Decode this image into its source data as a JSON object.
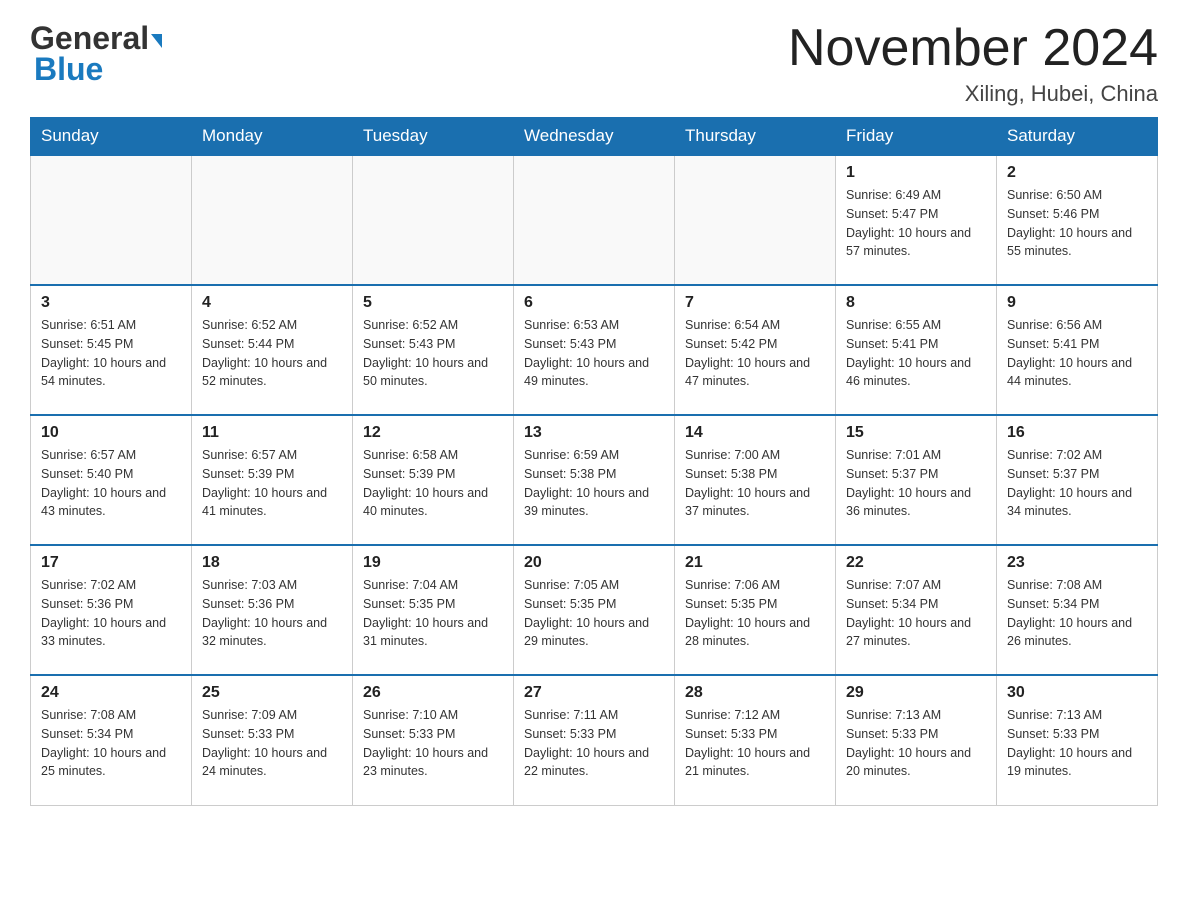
{
  "header": {
    "logo_general": "General",
    "logo_blue": "Blue",
    "month_year": "November 2024",
    "location": "Xiling, Hubei, China"
  },
  "weekdays": [
    "Sunday",
    "Monday",
    "Tuesday",
    "Wednesday",
    "Thursday",
    "Friday",
    "Saturday"
  ],
  "weeks": [
    [
      {
        "day": "",
        "sunrise": "",
        "sunset": "",
        "daylight": ""
      },
      {
        "day": "",
        "sunrise": "",
        "sunset": "",
        "daylight": ""
      },
      {
        "day": "",
        "sunrise": "",
        "sunset": "",
        "daylight": ""
      },
      {
        "day": "",
        "sunrise": "",
        "sunset": "",
        "daylight": ""
      },
      {
        "day": "",
        "sunrise": "",
        "sunset": "",
        "daylight": ""
      },
      {
        "day": "1",
        "sunrise": "Sunrise: 6:49 AM",
        "sunset": "Sunset: 5:47 PM",
        "daylight": "Daylight: 10 hours and 57 minutes."
      },
      {
        "day": "2",
        "sunrise": "Sunrise: 6:50 AM",
        "sunset": "Sunset: 5:46 PM",
        "daylight": "Daylight: 10 hours and 55 minutes."
      }
    ],
    [
      {
        "day": "3",
        "sunrise": "Sunrise: 6:51 AM",
        "sunset": "Sunset: 5:45 PM",
        "daylight": "Daylight: 10 hours and 54 minutes."
      },
      {
        "day": "4",
        "sunrise": "Sunrise: 6:52 AM",
        "sunset": "Sunset: 5:44 PM",
        "daylight": "Daylight: 10 hours and 52 minutes."
      },
      {
        "day": "5",
        "sunrise": "Sunrise: 6:52 AM",
        "sunset": "Sunset: 5:43 PM",
        "daylight": "Daylight: 10 hours and 50 minutes."
      },
      {
        "day": "6",
        "sunrise": "Sunrise: 6:53 AM",
        "sunset": "Sunset: 5:43 PM",
        "daylight": "Daylight: 10 hours and 49 minutes."
      },
      {
        "day": "7",
        "sunrise": "Sunrise: 6:54 AM",
        "sunset": "Sunset: 5:42 PM",
        "daylight": "Daylight: 10 hours and 47 minutes."
      },
      {
        "day": "8",
        "sunrise": "Sunrise: 6:55 AM",
        "sunset": "Sunset: 5:41 PM",
        "daylight": "Daylight: 10 hours and 46 minutes."
      },
      {
        "day": "9",
        "sunrise": "Sunrise: 6:56 AM",
        "sunset": "Sunset: 5:41 PM",
        "daylight": "Daylight: 10 hours and 44 minutes."
      }
    ],
    [
      {
        "day": "10",
        "sunrise": "Sunrise: 6:57 AM",
        "sunset": "Sunset: 5:40 PM",
        "daylight": "Daylight: 10 hours and 43 minutes."
      },
      {
        "day": "11",
        "sunrise": "Sunrise: 6:57 AM",
        "sunset": "Sunset: 5:39 PM",
        "daylight": "Daylight: 10 hours and 41 minutes."
      },
      {
        "day": "12",
        "sunrise": "Sunrise: 6:58 AM",
        "sunset": "Sunset: 5:39 PM",
        "daylight": "Daylight: 10 hours and 40 minutes."
      },
      {
        "day": "13",
        "sunrise": "Sunrise: 6:59 AM",
        "sunset": "Sunset: 5:38 PM",
        "daylight": "Daylight: 10 hours and 39 minutes."
      },
      {
        "day": "14",
        "sunrise": "Sunrise: 7:00 AM",
        "sunset": "Sunset: 5:38 PM",
        "daylight": "Daylight: 10 hours and 37 minutes."
      },
      {
        "day": "15",
        "sunrise": "Sunrise: 7:01 AM",
        "sunset": "Sunset: 5:37 PM",
        "daylight": "Daylight: 10 hours and 36 minutes."
      },
      {
        "day": "16",
        "sunrise": "Sunrise: 7:02 AM",
        "sunset": "Sunset: 5:37 PM",
        "daylight": "Daylight: 10 hours and 34 minutes."
      }
    ],
    [
      {
        "day": "17",
        "sunrise": "Sunrise: 7:02 AM",
        "sunset": "Sunset: 5:36 PM",
        "daylight": "Daylight: 10 hours and 33 minutes."
      },
      {
        "day": "18",
        "sunrise": "Sunrise: 7:03 AM",
        "sunset": "Sunset: 5:36 PM",
        "daylight": "Daylight: 10 hours and 32 minutes."
      },
      {
        "day": "19",
        "sunrise": "Sunrise: 7:04 AM",
        "sunset": "Sunset: 5:35 PM",
        "daylight": "Daylight: 10 hours and 31 minutes."
      },
      {
        "day": "20",
        "sunrise": "Sunrise: 7:05 AM",
        "sunset": "Sunset: 5:35 PM",
        "daylight": "Daylight: 10 hours and 29 minutes."
      },
      {
        "day": "21",
        "sunrise": "Sunrise: 7:06 AM",
        "sunset": "Sunset: 5:35 PM",
        "daylight": "Daylight: 10 hours and 28 minutes."
      },
      {
        "day": "22",
        "sunrise": "Sunrise: 7:07 AM",
        "sunset": "Sunset: 5:34 PM",
        "daylight": "Daylight: 10 hours and 27 minutes."
      },
      {
        "day": "23",
        "sunrise": "Sunrise: 7:08 AM",
        "sunset": "Sunset: 5:34 PM",
        "daylight": "Daylight: 10 hours and 26 minutes."
      }
    ],
    [
      {
        "day": "24",
        "sunrise": "Sunrise: 7:08 AM",
        "sunset": "Sunset: 5:34 PM",
        "daylight": "Daylight: 10 hours and 25 minutes."
      },
      {
        "day": "25",
        "sunrise": "Sunrise: 7:09 AM",
        "sunset": "Sunset: 5:33 PM",
        "daylight": "Daylight: 10 hours and 24 minutes."
      },
      {
        "day": "26",
        "sunrise": "Sunrise: 7:10 AM",
        "sunset": "Sunset: 5:33 PM",
        "daylight": "Daylight: 10 hours and 23 minutes."
      },
      {
        "day": "27",
        "sunrise": "Sunrise: 7:11 AM",
        "sunset": "Sunset: 5:33 PM",
        "daylight": "Daylight: 10 hours and 22 minutes."
      },
      {
        "day": "28",
        "sunrise": "Sunrise: 7:12 AM",
        "sunset": "Sunset: 5:33 PM",
        "daylight": "Daylight: 10 hours and 21 minutes."
      },
      {
        "day": "29",
        "sunrise": "Sunrise: 7:13 AM",
        "sunset": "Sunset: 5:33 PM",
        "daylight": "Daylight: 10 hours and 20 minutes."
      },
      {
        "day": "30",
        "sunrise": "Sunrise: 7:13 AM",
        "sunset": "Sunset: 5:33 PM",
        "daylight": "Daylight: 10 hours and 19 minutes."
      }
    ]
  ]
}
